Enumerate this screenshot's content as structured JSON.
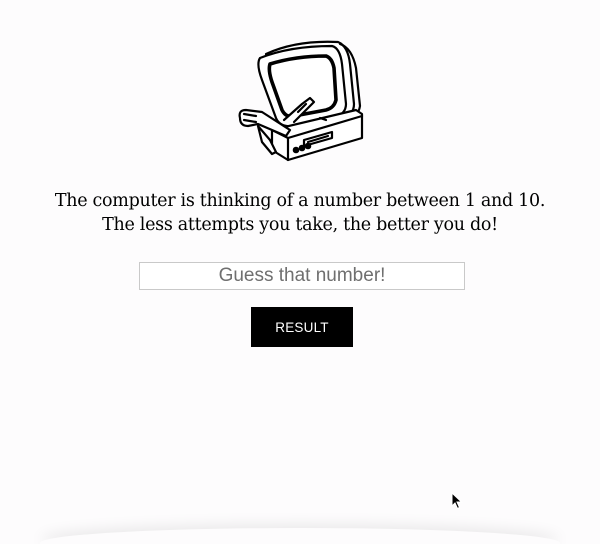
{
  "hero": {
    "icon": "retro-computer-illustration"
  },
  "intro": {
    "line1": "The computer is thinking of a number between 1 and 10.",
    "line2": "The less attempts you take, the better you do!"
  },
  "guess": {
    "placeholder": "Guess that number!",
    "value": ""
  },
  "result_button": {
    "label": "RESULT"
  },
  "cursor": {
    "icon": "mouse-pointer-icon"
  }
}
